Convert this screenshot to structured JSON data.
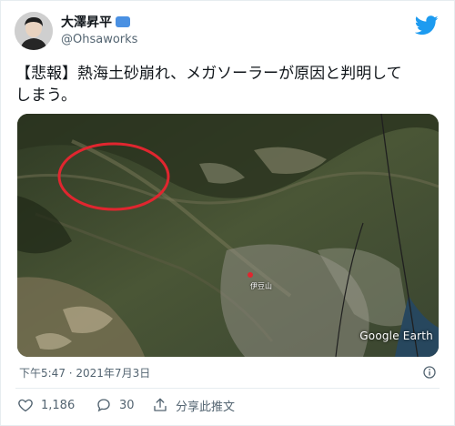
{
  "author": {
    "display_name": "大澤昇平",
    "handle": "@Ohsaworks",
    "verified_badge_icon": "verified-badge-icon"
  },
  "brand_icon": "twitter-bird-icon",
  "tweet": {
    "text": "【悲報】熱海土砂崩れ、メガソーラーが原因と判明して\nしまう。"
  },
  "media": {
    "map_label": "伊豆山",
    "watermark": "Google Earth"
  },
  "timestamp": "下午5:47 · 2021年7月3日",
  "actions": {
    "like_count": "1,186",
    "reply_count": "30",
    "share_label": "分享此推文"
  },
  "colors": {
    "accent": "#1d9bf0",
    "text_primary": "#0f1419",
    "text_secondary": "#536471",
    "highlight_circle": "#e0262f"
  }
}
